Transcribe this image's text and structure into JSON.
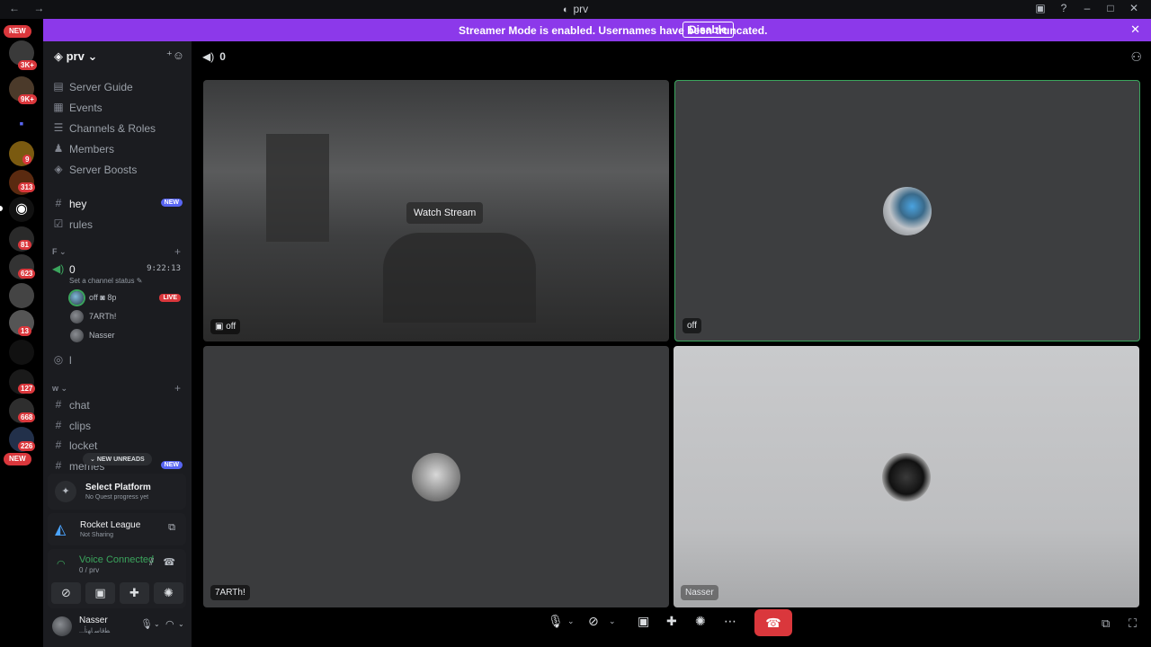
{
  "window": {
    "title": "prv",
    "nav": "← →"
  },
  "banner": {
    "text": "Streamer Mode is enabled. Usernames have been truncated.",
    "button": "Disable"
  },
  "rail": {
    "new_top": "NEW",
    "new_bottom": "NEW",
    "badges": [
      "3K+",
      "9K+",
      "9",
      "313",
      "81",
      "623",
      "13",
      "127",
      "668",
      "226"
    ]
  },
  "server": {
    "name": "prv",
    "menu": [
      {
        "label": "Server Guide",
        "icon": "book-icon"
      },
      {
        "label": "Events",
        "icon": "calendar-icon"
      },
      {
        "label": "Channels & Roles",
        "icon": "list-icon"
      },
      {
        "label": "Members",
        "icon": "members-icon"
      },
      {
        "label": "Server Boosts",
        "icon": "boost-icon"
      }
    ],
    "top_channels": [
      {
        "name": "hey",
        "badge": "NEW"
      },
      {
        "name": "rules",
        "badge": ""
      }
    ],
    "category_f": "F",
    "voice_channel": {
      "name": "0",
      "timer": "9:22:13",
      "status_hint": "Set a channel status"
    },
    "voice_users": [
      {
        "name": "off",
        "extra": "8p",
        "live": "LIVE"
      },
      {
        "name": "7ARTh!",
        "extra": "",
        "live": ""
      },
      {
        "name": "Nasser",
        "extra": "",
        "live": ""
      }
    ],
    "stage_channel": {
      "name": "l"
    },
    "category_w": "w",
    "w_channels": [
      {
        "name": "chat",
        "badge": ""
      },
      {
        "name": "clips",
        "badge": ""
      },
      {
        "name": "locket",
        "badge": ""
      },
      {
        "name": "memes",
        "badge": "NEW"
      }
    ],
    "new_unreads": "NEW UNREADS"
  },
  "quest": {
    "title": "Select Platform",
    "subtitle": "No Quest progress yet"
  },
  "game": {
    "title": "Rocket League",
    "subtitle": "Not Sharing"
  },
  "voice_status": {
    "title": "Voice Connected",
    "subtitle": "0 / prv"
  },
  "user": {
    "name": "Nasser",
    "status": "...ﻄﻗﺎﺳ ﺎﻬﻧﺃ"
  },
  "stage": {
    "count": "0",
    "tiles": [
      {
        "label": "off",
        "overlay": "Watch Stream"
      },
      {
        "label": "off"
      },
      {
        "label": "7ARTh!"
      },
      {
        "label": "Nasser"
      }
    ]
  },
  "colors": {
    "banner": "#8c39ea",
    "accent": "#5865f2",
    "danger": "#da373c",
    "speaking": "#3ba55d"
  }
}
